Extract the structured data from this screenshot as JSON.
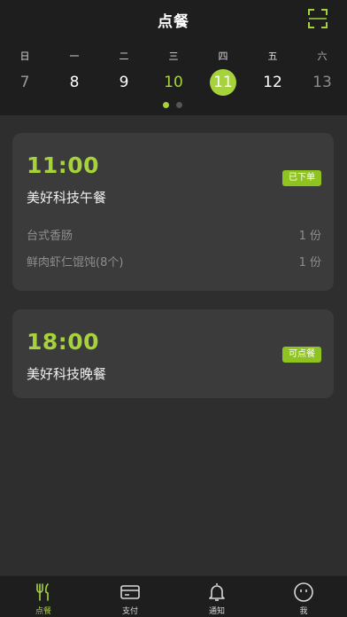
{
  "header": {
    "title": "点餐"
  },
  "week": [
    {
      "weekday": "日",
      "date": "7",
      "state": "past"
    },
    {
      "weekday": "一",
      "date": "8",
      "state": "normal"
    },
    {
      "weekday": "二",
      "date": "9",
      "state": "normal"
    },
    {
      "weekday": "三",
      "date": "10",
      "state": "accent"
    },
    {
      "weekday": "四",
      "date": "11",
      "state": "selected"
    },
    {
      "weekday": "五",
      "date": "12",
      "state": "normal"
    },
    {
      "weekday": "六",
      "date": "13",
      "state": "faded"
    }
  ],
  "pager": {
    "pages": 2,
    "current": 1
  },
  "meals": [
    {
      "time": "11:00",
      "name": "美好科技午餐",
      "status": "已下单",
      "items": [
        {
          "name": "台式香肠",
          "qty": "1 份"
        },
        {
          "name": "鲜肉虾仁馄饨(8个)",
          "qty": "1 份"
        }
      ]
    },
    {
      "time": "18:00",
      "name": "美好科技晚餐",
      "status": "可点餐",
      "items": []
    }
  ],
  "tabbar": {
    "items": [
      {
        "label": "点餐",
        "icon": "fork-knife-icon",
        "active": true
      },
      {
        "label": "支付",
        "icon": "card-icon",
        "active": false
      },
      {
        "label": "通知",
        "icon": "bell-icon",
        "active": false
      },
      {
        "label": "我",
        "icon": "face-icon",
        "active": false
      }
    ]
  },
  "colors": {
    "accent": "#a6d23c",
    "badge": "#8fc31f",
    "header_bg": "#1e1e1e",
    "page_bg": "#2e2e2e",
    "card_bg": "#3b3b3b"
  }
}
